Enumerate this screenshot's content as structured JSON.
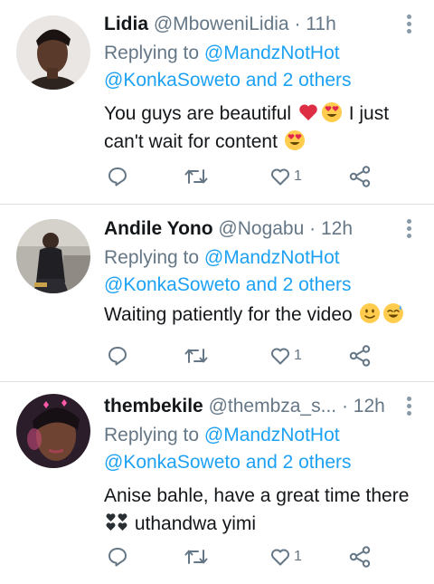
{
  "tweets": [
    {
      "name": "Lidia",
      "handle": "@MboweniLidia",
      "separator": "·",
      "time": "11h",
      "replying_prefix": "Replying to ",
      "replying_to": "@MandzNotHot",
      "replying_line2": "@KonkaSoweto and 2 others",
      "text_parts": [
        "You guys are beautiful ",
        " I just can't wait for content "
      ],
      "emojis": [
        "red-heart",
        "heart-eyes",
        "heart-eyes"
      ],
      "likes": "1"
    },
    {
      "name": "Andile Yono",
      "handle": "@Nogabu",
      "separator": "·",
      "time": "12h",
      "replying_prefix": "Replying to ",
      "replying_to": "@MandzNotHot",
      "replying_line2": "@KonkaSoweto and 2 others",
      "text_parts": [
        "Waiting patiently for the video "
      ],
      "emojis": [
        "slight-smile",
        "sweat-smile"
      ],
      "likes": "1"
    },
    {
      "name": "thembekile",
      "handle": "@thembza_s...",
      "separator": "·",
      "time": "12h",
      "replying_prefix": "Replying to ",
      "replying_to": "@MandzNotHot",
      "replying_line2": "@KonkaSoweto and 2 others",
      "text_parts": [
        "Anise bahle, have a great time there",
        " uthandwa yimi"
      ],
      "emojis": [
        "black-hearts"
      ],
      "likes": "1"
    }
  ],
  "colors": {
    "link": "#1da1f2",
    "muted": "#657786",
    "icon": "#657786",
    "text": "#14171a"
  }
}
